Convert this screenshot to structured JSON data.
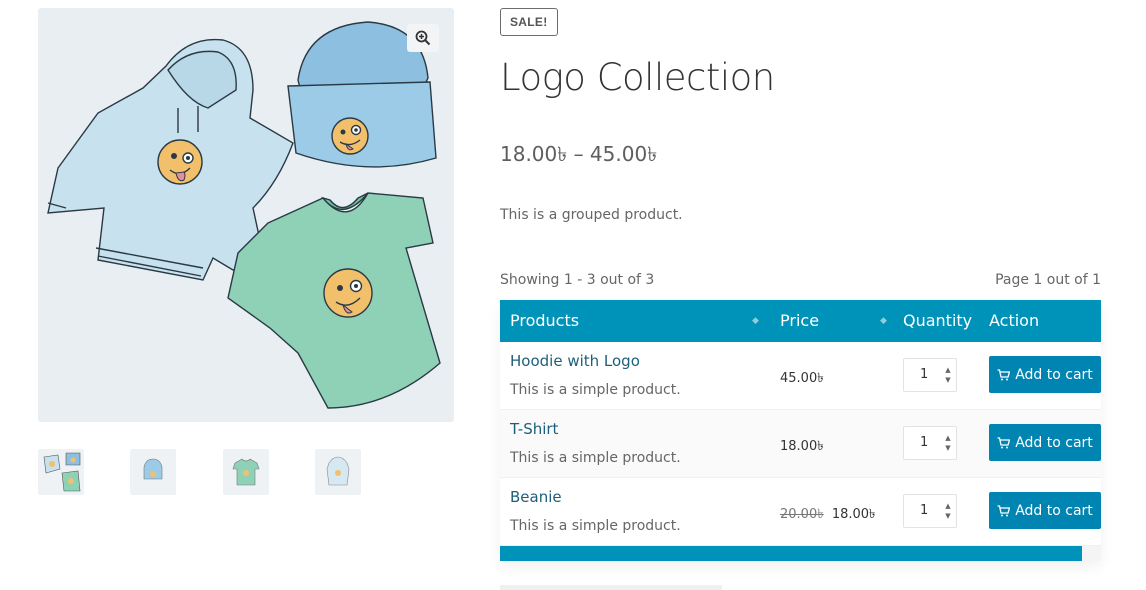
{
  "product": {
    "badge": "SALE!",
    "title": "Logo Collection",
    "price_range": "18.00৳ – 45.00৳",
    "short_description": "This is a grouped product."
  },
  "gallery": {
    "zoom_icon": "magnifier-plus-icon",
    "thumbnails": [
      "logo-collection-thumb",
      "beanie-thumb",
      "tshirt-thumb",
      "hoodie-thumb"
    ]
  },
  "table": {
    "showing": "Showing 1 - 3 out of 3",
    "page_info": "Page 1 out of 1",
    "headers": [
      "Products",
      "Price",
      "Quantity",
      "Action"
    ],
    "rows": [
      {
        "name": "Hoodie with Logo",
        "desc": "This is a simple product.",
        "old_price": "",
        "price": "45.00৳",
        "qty": "1",
        "action": "Add to cart"
      },
      {
        "name": "T-Shirt",
        "desc": "This is a simple product.",
        "old_price": "",
        "price": "18.00৳",
        "qty": "1",
        "action": "Add to cart"
      },
      {
        "name": "Beanie",
        "desc": "This is a simple product.",
        "old_price": "20.00৳",
        "price": "18.00৳",
        "qty": "1",
        "action": "Add to cart"
      }
    ]
  },
  "colors": {
    "accent": "#0093b9",
    "button": "#0085b2",
    "link": "#1d5f7a"
  }
}
